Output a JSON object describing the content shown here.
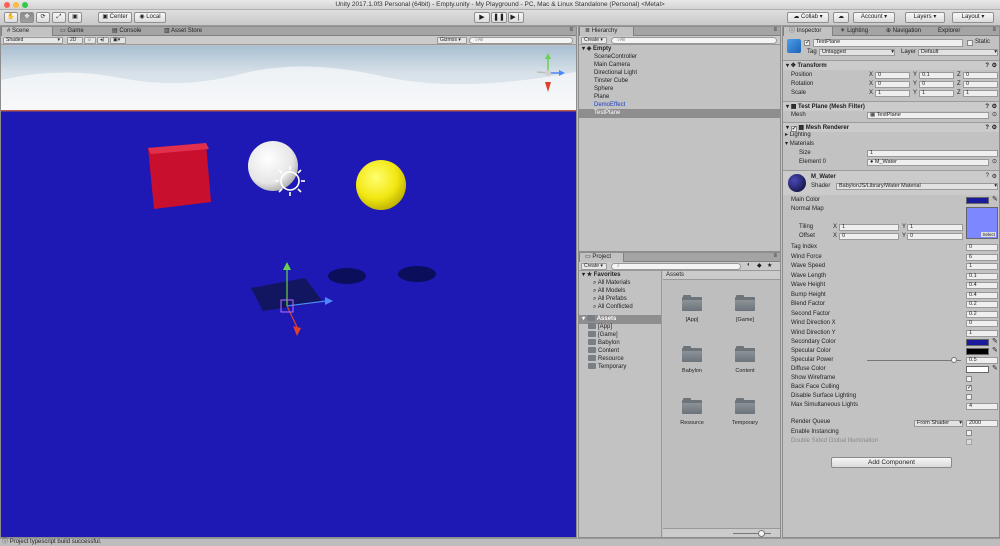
{
  "window": {
    "title": "Unity 2017.1.0f3 Personal (64bit) - Empty.unity - My Playground - PC, Mac & Linux Standalone (Personal) <Metal>"
  },
  "toolbar": {
    "pivot_label": "Center",
    "space_label": "Local",
    "collab_label": "Collab ▾",
    "cloud_icon": "cloud-icon",
    "account_label": "Account",
    "layers_label": "Layers",
    "layout_label": "Layout"
  },
  "scene": {
    "tabs": [
      "Scene",
      "Game",
      "Console",
      "Asset Store"
    ],
    "shading_mode": "Shaded",
    "mode_2d": "2D",
    "gizmos_label": "Gizmos ▾",
    "search_placeholder": "All",
    "colors": {
      "water": "#1e18b4",
      "sky_top": "#cfd9e2",
      "cube": "#c8102e",
      "sphere_yellow": "#f5ea10",
      "sphere_white": "#f2f2f2"
    }
  },
  "hierarchy": {
    "tab": "Hierarchy",
    "create_label": "Create ▾",
    "search_placeholder": "All",
    "scene_name": "Empty",
    "items": [
      "SceneController",
      "Main Camera",
      "Directional Light",
      "Tinster Cube",
      "Sphere",
      "Plane",
      "DemoEffect",
      "TestPlane"
    ],
    "selected_index": 7
  },
  "project": {
    "tab": "Project",
    "create_label": "Create ▾",
    "favorites_label": "Favorites",
    "favorites": [
      "All Materials",
      "All Models",
      "All Prefabs",
      "All Conflicted"
    ],
    "assets_label": "Assets",
    "asset_folders": [
      "[App]",
      "[Game]",
      "Babylon",
      "Content",
      "Resource",
      "Temporary"
    ],
    "breadcrumb": "Assets",
    "grid_folders": [
      "[App]",
      "[Game]",
      "Babylon",
      "Content",
      "Resource",
      "Temporary"
    ]
  },
  "inspector": {
    "tabs": [
      "Inspector",
      "Lighting",
      "Navigation",
      "Explorer"
    ],
    "object_name": "TestPlane",
    "static_label": "Static",
    "tag_label": "Tag",
    "tag_value": "Untagged",
    "layer_label": "Layer",
    "layer_value": "Default",
    "transform": {
      "title": "Transform",
      "position_label": "Position",
      "position": [
        "0",
        "0.1",
        "0"
      ],
      "rotation_label": "Rotation",
      "rotation": [
        "0",
        "0",
        "0"
      ],
      "scale_label": "Scale",
      "scale": [
        "1",
        "1",
        "1"
      ]
    },
    "mesh_filter": {
      "title": "Test Plane (Mesh Filter)",
      "mesh_label": "Mesh",
      "mesh_value": "TestPlane"
    },
    "mesh_renderer": {
      "title": "Mesh Renderer",
      "lighting_label": "Lighting",
      "materials_label": "Materials",
      "size_label": "Size",
      "size_value": "1",
      "element_label": "Element 0",
      "element_value": "M_Water"
    },
    "material": {
      "name": "M_Water",
      "shader_label": "Shader",
      "shader_value": "BabylonJS/Library/Water Material",
      "main_color_label": "Main Color",
      "normal_map_label": "Normal Map",
      "tiling_label": "Tiling",
      "offset_label": "Offset",
      "tiling": [
        "1",
        "1"
      ],
      "offset": [
        "0",
        "0"
      ],
      "select_label": "Select",
      "properties": [
        {
          "label": "Tag Index",
          "value": "0"
        },
        {
          "label": "Wind Force",
          "value": "6"
        },
        {
          "label": "Wave Speed",
          "value": "1"
        },
        {
          "label": "Wave Length",
          "value": "0.1"
        },
        {
          "label": "Wave Height",
          "value": "0.4"
        },
        {
          "label": "Bump Height",
          "value": "0.4"
        },
        {
          "label": "Blend Factor",
          "value": "0.2"
        },
        {
          "label": "Second Factor",
          "value": "0.2"
        },
        {
          "label": "Wind Direction X",
          "value": "0"
        },
        {
          "label": "Wind Direction Y",
          "value": "1"
        }
      ],
      "secondary_color_label": "Secondary Color",
      "specular_color_label": "Specular Color",
      "specular_power_label": "Specular Power",
      "specular_power_value": "0.5",
      "specular_power_fraction": 0.93,
      "diffuse_color_label": "Diffuse Color",
      "show_wireframe_label": "Show Wireframe",
      "back_face_label": "Back Face Culling",
      "disable_lighting_label": "Disable Surface Lighting",
      "max_lights_label": "Max Simultaneous Lights",
      "max_lights_value": "4",
      "render_queue_label": "Render Queue",
      "render_queue_mode": "From Shader",
      "render_queue_value": "2000",
      "instancing_label": "Enable Instancing",
      "double_sided_label": "Double Sided Global Illumination",
      "colors": {
        "main": "#1a1a9c",
        "secondary": "#1a1a9c",
        "specular": "#000000",
        "diffuse": "#ffffff",
        "normal_map": "#7d87ff"
      }
    },
    "add_component_label": "Add Component"
  },
  "status": {
    "message": "Project typescript build successful."
  }
}
